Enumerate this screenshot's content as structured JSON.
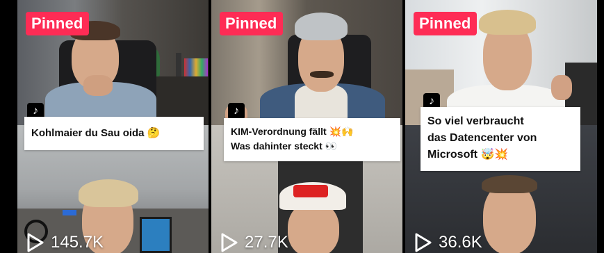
{
  "grid": {
    "videos": [
      {
        "pinned_label": "Pinned",
        "caption": "Kohlmaier du Sau oida 🤔",
        "views": "145.7K"
      },
      {
        "pinned_label": "Pinned",
        "caption_line1": "KIM-Verordnung fällt 💥🙌",
        "caption_line2": "Was dahinter steckt 👀",
        "views": "27.7K"
      },
      {
        "pinned_label": "Pinned",
        "caption_line1": "So viel verbraucht",
        "caption_line2": "das Datencenter von",
        "caption_line3": "Microsoft 🤯💥",
        "views": "36.6K"
      }
    ]
  },
  "icons": {
    "platform_logo": "tiktok-icon",
    "views_icon": "play-icon"
  },
  "colors": {
    "pinned_badge": "#fe2c55",
    "background": "#000000",
    "caption_bg": "#ffffff"
  }
}
